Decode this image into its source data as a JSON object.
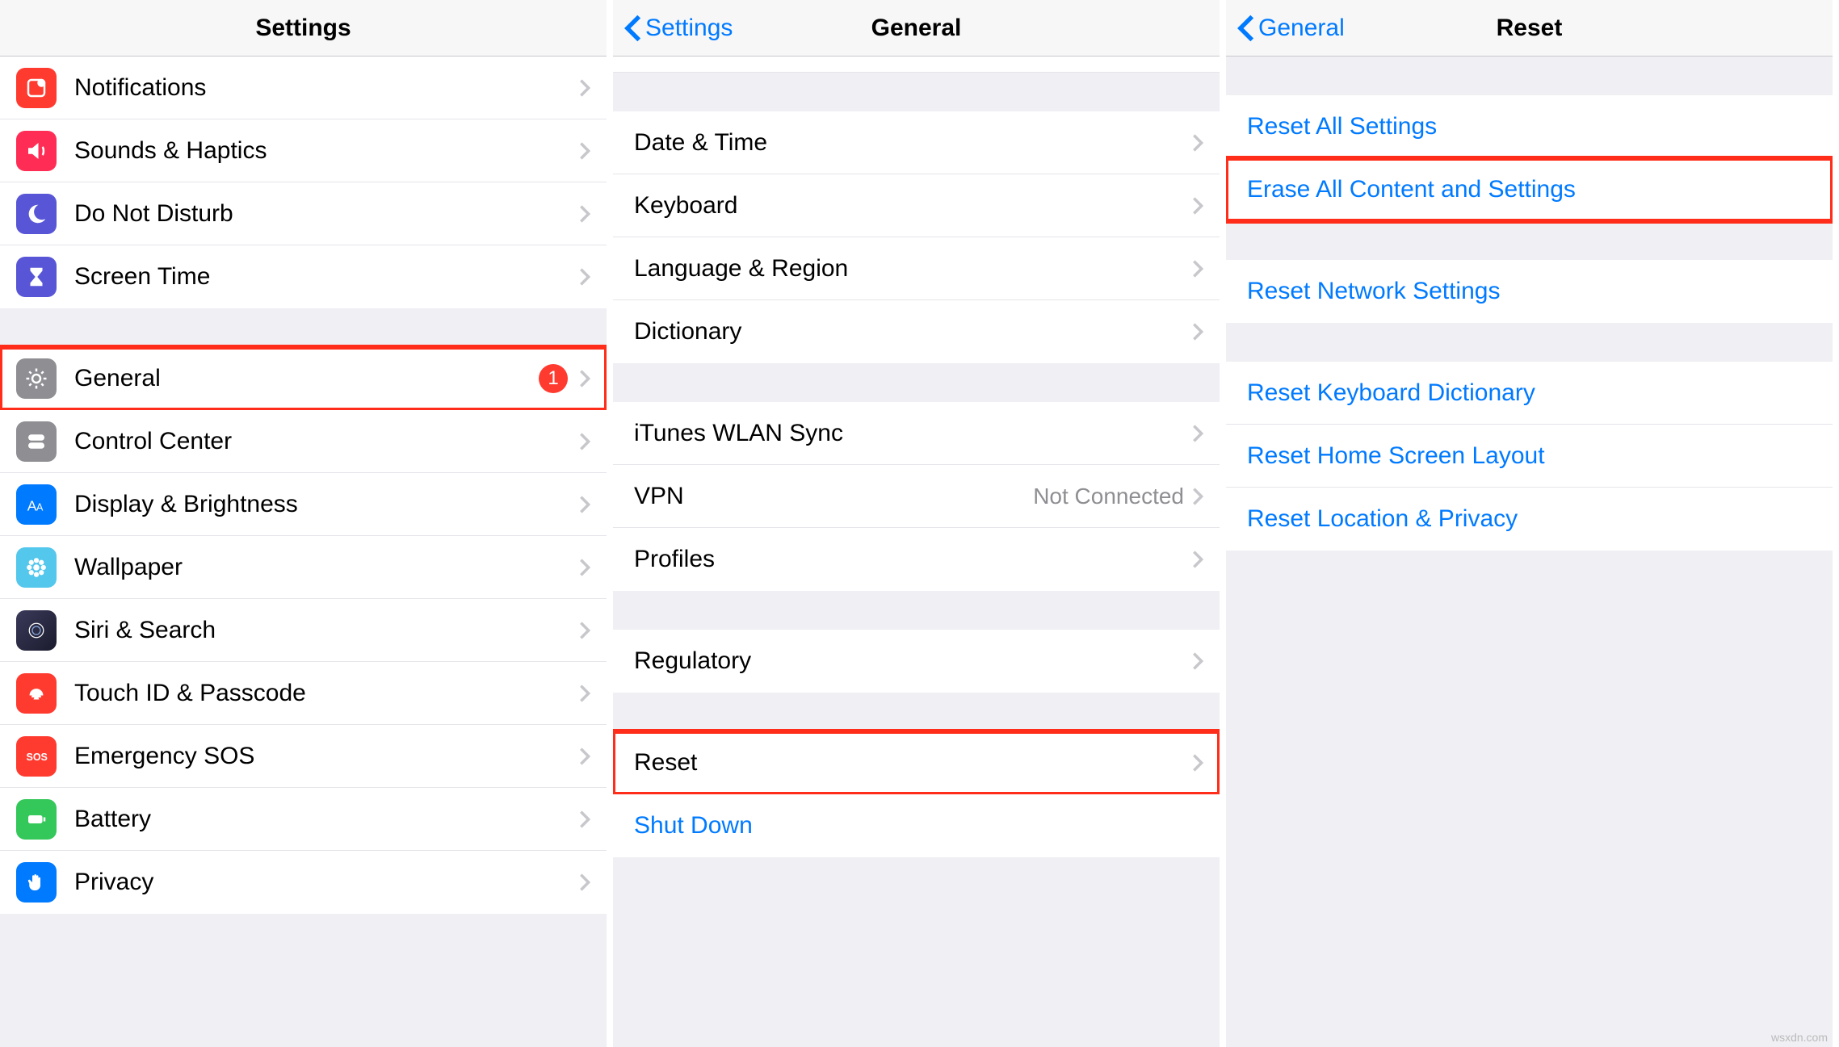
{
  "panel1": {
    "title": "Settings",
    "rows": [
      {
        "label": "Notifications"
      },
      {
        "label": "Sounds & Haptics"
      },
      {
        "label": "Do Not Disturb"
      },
      {
        "label": "Screen Time"
      }
    ],
    "rows2": [
      {
        "label": "General",
        "badge": "1"
      },
      {
        "label": "Control Center"
      },
      {
        "label": "Display & Brightness"
      },
      {
        "label": "Wallpaper"
      },
      {
        "label": "Siri & Search"
      },
      {
        "label": "Touch ID & Passcode"
      },
      {
        "label": "Emergency SOS"
      },
      {
        "label": "Battery"
      },
      {
        "label": "Privacy"
      }
    ]
  },
  "panel2": {
    "back": "Settings",
    "title": "General",
    "groupA": [
      {
        "label": "Date & Time"
      },
      {
        "label": "Keyboard"
      },
      {
        "label": "Language & Region"
      },
      {
        "label": "Dictionary"
      }
    ],
    "groupB": [
      {
        "label": "iTunes WLAN Sync"
      },
      {
        "label": "VPN",
        "detail": "Not Connected"
      },
      {
        "label": "Profiles"
      }
    ],
    "groupC": [
      {
        "label": "Regulatory"
      }
    ],
    "groupD": [
      {
        "label": "Reset"
      },
      {
        "label": "Shut Down",
        "link": true
      }
    ]
  },
  "panel3": {
    "back": "General",
    "title": "Reset",
    "groupA": [
      {
        "label": "Reset All Settings"
      },
      {
        "label": "Erase All Content and Settings"
      }
    ],
    "groupB": [
      {
        "label": "Reset Network Settings"
      }
    ],
    "groupC": [
      {
        "label": "Reset Keyboard Dictionary"
      },
      {
        "label": "Reset Home Screen Layout"
      },
      {
        "label": "Reset Location & Privacy"
      }
    ]
  },
  "watermark": "wsxdn.com"
}
